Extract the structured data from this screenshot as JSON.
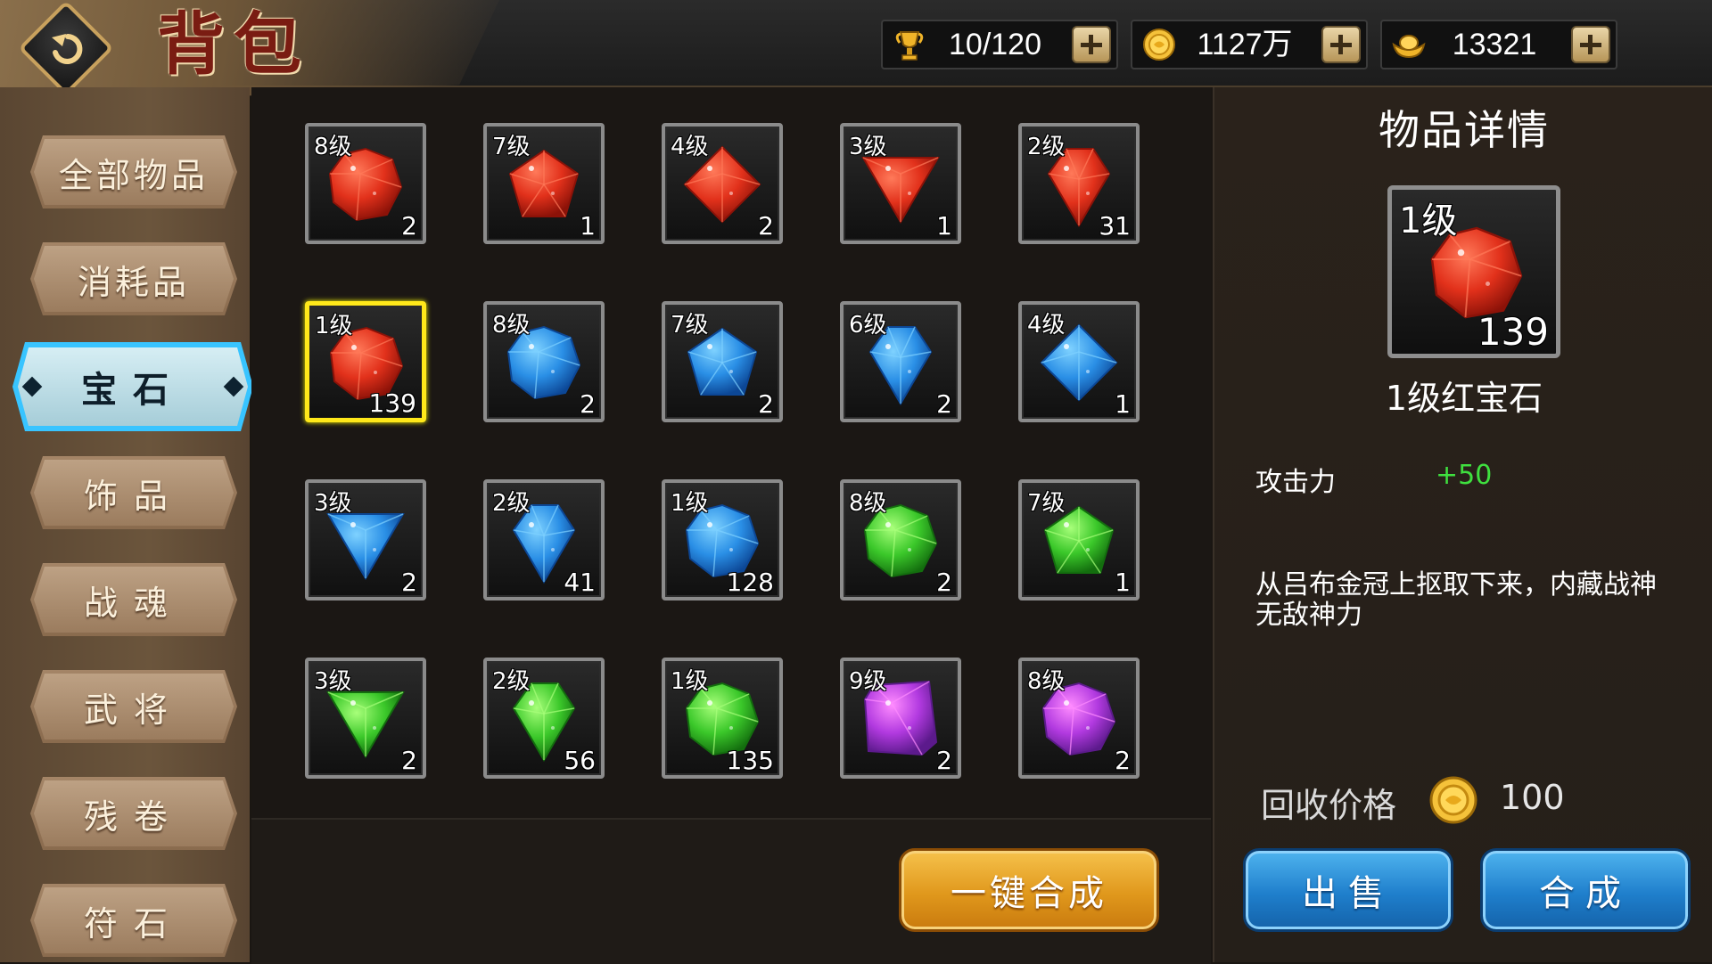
{
  "header": {
    "title": "背包",
    "resources": [
      {
        "icon": "trophy-icon",
        "value": "10/120"
      },
      {
        "icon": "gold-coin-icon",
        "value": "1127万"
      },
      {
        "icon": "gold-ingot-icon",
        "value": "13321"
      }
    ]
  },
  "sidebar": {
    "items": [
      {
        "label": "全部物品"
      },
      {
        "label": "消耗品"
      },
      {
        "label": "宝石"
      },
      {
        "label": "饰品"
      },
      {
        "label": "战魂"
      },
      {
        "label": "武将"
      },
      {
        "label": "残卷"
      },
      {
        "label": "符石"
      }
    ],
    "active_index": 2
  },
  "grid": {
    "gems": [
      {
        "level": "8级",
        "count": "2",
        "color": "red",
        "shape": "round"
      },
      {
        "level": "7级",
        "count": "1",
        "color": "red",
        "shape": "pentagon"
      },
      {
        "level": "4级",
        "count": "2",
        "color": "red",
        "shape": "diamond"
      },
      {
        "level": "3级",
        "count": "1",
        "color": "red",
        "shape": "triangle"
      },
      {
        "level": "2级",
        "count": "31",
        "color": "red",
        "shape": "drop"
      },
      {
        "level": "1级",
        "count": "139",
        "color": "red",
        "shape": "round",
        "selected": true
      },
      {
        "level": "8级",
        "count": "2",
        "color": "blue",
        "shape": "round"
      },
      {
        "level": "7级",
        "count": "2",
        "color": "blue",
        "shape": "pentagon"
      },
      {
        "level": "6级",
        "count": "2",
        "color": "blue",
        "shape": "drop"
      },
      {
        "level": "4级",
        "count": "1",
        "color": "blue",
        "shape": "diamond"
      },
      {
        "level": "3级",
        "count": "2",
        "color": "blue",
        "shape": "triangle"
      },
      {
        "level": "2级",
        "count": "41",
        "color": "blue",
        "shape": "drop"
      },
      {
        "level": "1级",
        "count": "128",
        "color": "blue",
        "shape": "round"
      },
      {
        "level": "8级",
        "count": "2",
        "color": "green",
        "shape": "round"
      },
      {
        "level": "7级",
        "count": "1",
        "color": "green",
        "shape": "pentagon"
      },
      {
        "level": "3级",
        "count": "2",
        "color": "green",
        "shape": "triangle"
      },
      {
        "level": "2级",
        "count": "56",
        "color": "green",
        "shape": "drop"
      },
      {
        "level": "1级",
        "count": "135",
        "color": "green",
        "shape": "round"
      },
      {
        "level": "9级",
        "count": "2",
        "color": "purple",
        "shape": "square"
      },
      {
        "level": "8级",
        "count": "2",
        "color": "purple",
        "shape": "round"
      }
    ],
    "colors": {
      "red": [
        "#ff7a5a",
        "#e2311b",
        "#8c1208"
      ],
      "blue": [
        "#7fd2ff",
        "#2a8fe6",
        "#0c4796"
      ],
      "green": [
        "#a8ff7a",
        "#3bc82a",
        "#136e0e"
      ],
      "purple": [
        "#ff8cff",
        "#b23ae0",
        "#5c1a8c"
      ]
    }
  },
  "bottom": {
    "merge_all_label": "一键合成"
  },
  "detail": {
    "title": "物品详情",
    "item_level": "1级",
    "item_count": "139",
    "item_name": "1级红宝石",
    "stat_label": "攻击力",
    "stat_value": "+50",
    "description": "从吕布金冠上抠取下来，内藏战神无敌神力",
    "price_label": "回收价格",
    "price_value": "100",
    "sell_label": "出售",
    "merge_label": "合成"
  },
  "colors": {
    "selected_border": "#ffe81a",
    "active_tab": "#38c4ff",
    "stat_positive": "#3fe03f"
  }
}
